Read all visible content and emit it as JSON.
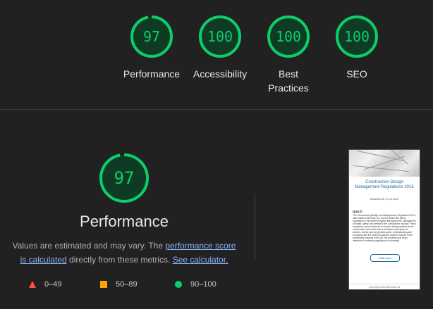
{
  "summary": {
    "gauges": [
      {
        "score": "97",
        "label": "Performance",
        "fraction": 0.97
      },
      {
        "score": "100",
        "label": "Accessibility",
        "fraction": 1.0
      },
      {
        "score": "100",
        "label_line1": "Best",
        "label_line2": "Practices",
        "fraction": 1.0
      },
      {
        "score": "100",
        "label": "SEO",
        "fraction": 1.0
      }
    ]
  },
  "detail": {
    "score": "97",
    "fraction": 0.97,
    "title": "Performance",
    "desc_prefix": "Values are estimated and may vary. The ",
    "link_score_1": "performance score",
    "link_score_2": "is calculated",
    "desc_middle": " directly from these metrics. ",
    "link_calculator": "See calculator.",
    "legend": [
      {
        "range": "0–49",
        "shape": "triangle",
        "color": "#ff4e42"
      },
      {
        "range": "50–89",
        "shape": "square",
        "color": "#ffa400"
      },
      {
        "range": "90–100",
        "shape": "circle",
        "color": "#0cce6b"
      }
    ]
  },
  "colors": {
    "pass": "#0cce6b",
    "pass_bg": "#0f3a23",
    "background": "#212121"
  },
  "thumbnail": {
    "title": "Construction Design Management Regulations 2015",
    "meta": "Aleksandr Ali | 23-11-2023",
    "heading": "Quiz it",
    "body": "The Construction (Design and Management) Regulations 2015, often called CDM 2015, are a set of health and safety regulations in the United Kingdom that govern the management of health, safety, and welfare in the construction industry. These regulations were introduced to improve safety practices in the construction sector and reduce accidents and injuries to workers, clients, and the general public. Understanding and complying with the CDM is crucial for anyone involved in the construction industry in the UK; the provided quiz helps determine if reviewing regulations is necessary.",
    "button": "Start Quiz",
    "footer": "Copyright 2023 Aleksandr Ali"
  }
}
